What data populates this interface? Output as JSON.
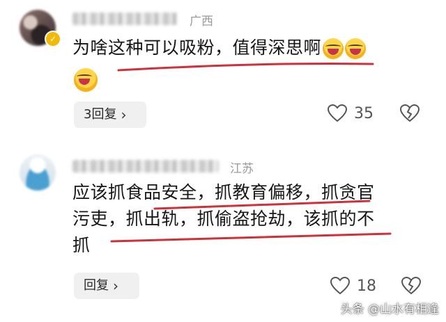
{
  "comments": [
    {
      "location": "广西",
      "text_line1": "为啥这种可以吸粉，值得深思啊",
      "reply_label": "3回复",
      "likes": "35"
    },
    {
      "location": "江苏",
      "text_line1": "应该抓食品安全，抓教育偏移，抓贪官",
      "text_line2": "污吏，抓出轨，抓偷盗抢劫，该抓的不",
      "text_line3": "抓",
      "reply_label": "回复",
      "likes": "18"
    }
  ],
  "watermark": "头条 @山水有相逢",
  "colors": {
    "underline": "#d0303a",
    "reply_bg": "#f0f0f0",
    "meta_text": "#9a9a9a"
  },
  "icons": [
    "heart-icon",
    "broken-heart-icon",
    "chevron-right-icon",
    "emoji-laughing-icon"
  ]
}
